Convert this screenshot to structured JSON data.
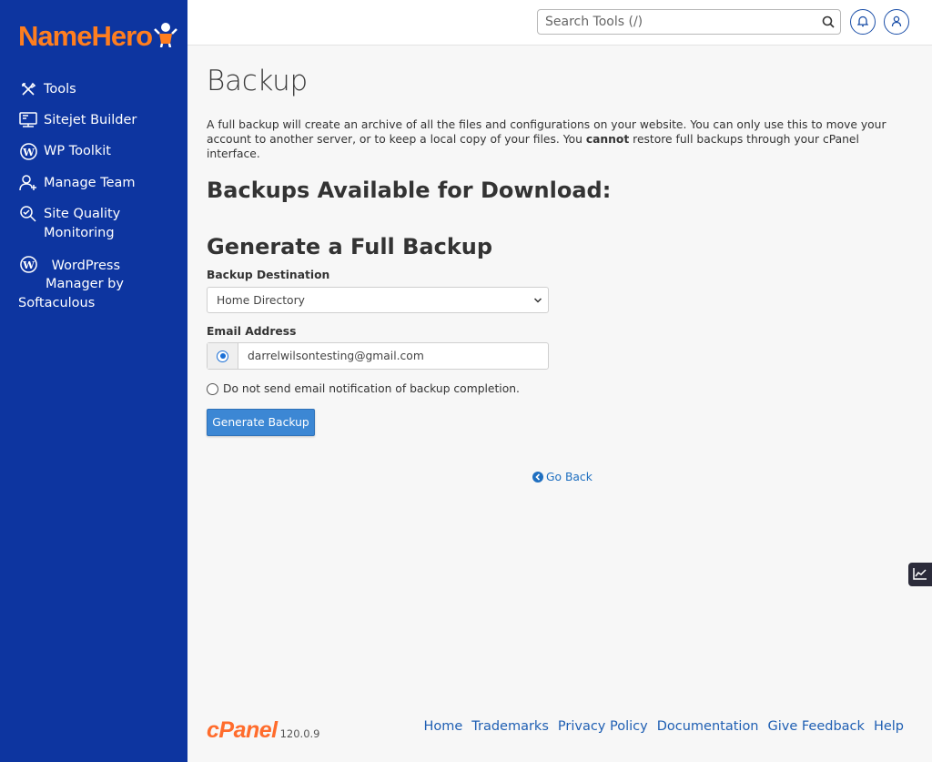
{
  "brand": {
    "name_part1": "Name",
    "name_part2": "Hero",
    "accent": "#ff7e1f",
    "sidebar_bg": "#0d35a0"
  },
  "sidebar": {
    "items": [
      {
        "label": "Tools",
        "icon": "tools-icon"
      },
      {
        "label": "Sitejet Builder",
        "icon": "monitor-icon"
      },
      {
        "label": "WP Toolkit",
        "icon": "wordpress-icon"
      },
      {
        "label": "Manage Team",
        "icon": "user-plus-icon"
      },
      {
        "label": "Site Quality Monitoring",
        "label_line1": "Site Quality",
        "label_line2": "Monitoring",
        "icon": "magnifier-icon"
      },
      {
        "label": "WordPress Manager by Softaculous",
        "label_line1": "WordPress",
        "label_line2": "Manager by",
        "label_line3": "Softaculous",
        "icon": "wordpress-icon"
      }
    ]
  },
  "topbar": {
    "search_placeholder": "Search Tools (/)",
    "notifications_icon": "bell-icon",
    "user_icon": "user-icon"
  },
  "main": {
    "title": "Backup",
    "intro_part1": "A full backup will create an archive of all the files and configurations on your website. You can only use this to move your account to another server, or to keep a local copy of your files. You ",
    "intro_bold": "cannot",
    "intro_part2": " restore full backups through your cPanel interface.",
    "available_heading": "Backups Available for Download:",
    "generate_heading": "Generate a Full Backup",
    "destination_label": "Backup Destination",
    "destination_value": "Home Directory",
    "email_label": "Email Address",
    "email_value": "darrelwilsontesting@gmail.com",
    "no_email_option": "Do not send email notification of backup completion.",
    "generate_button": "Generate Backup",
    "go_back": "Go Back"
  },
  "footer": {
    "cpanel_logo": "cPanel",
    "version": "120.0.9",
    "links": [
      "Home",
      "Trademarks",
      "Privacy Policy",
      "Documentation",
      "Give Feedback",
      "Help"
    ]
  }
}
